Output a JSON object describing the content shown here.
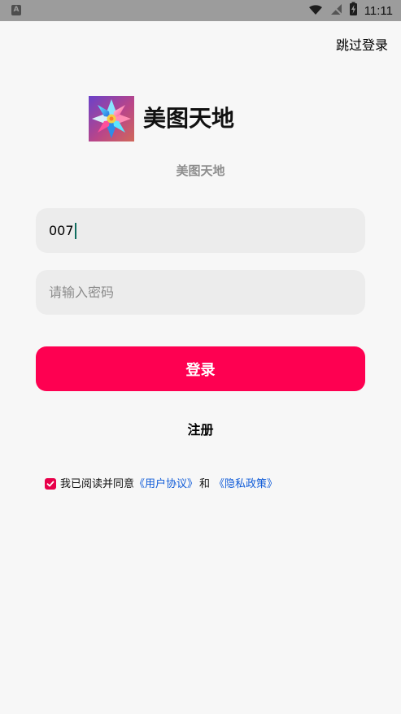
{
  "status_bar": {
    "app_indicator": "A",
    "time": "11:11"
  },
  "header": {
    "skip_login": "跳过登录"
  },
  "brand": {
    "title": "美图天地",
    "subtitle": "美图天地"
  },
  "form": {
    "username_value": "007",
    "password_placeholder": "请输入密码",
    "login_label": "登录",
    "register_label": "注册"
  },
  "agreement": {
    "checked": true,
    "prefix": "我已阅读并同意",
    "user_agreement": "《用户协议》",
    "and_text": "和",
    "privacy_policy": "《隐私政策》"
  },
  "icons": {
    "status_wifi": "wifi-icon",
    "status_signal": "no-signal-icon",
    "status_battery": "battery-charging-icon",
    "logo": "flower-logo-icon",
    "checkbox": "checkmark-icon"
  },
  "colors": {
    "primary": "#fe0051",
    "link": "#0f5bd8",
    "field_background": "#ececec",
    "page_background": "#f7f7f7",
    "status_bar": "#9c9c9c"
  }
}
